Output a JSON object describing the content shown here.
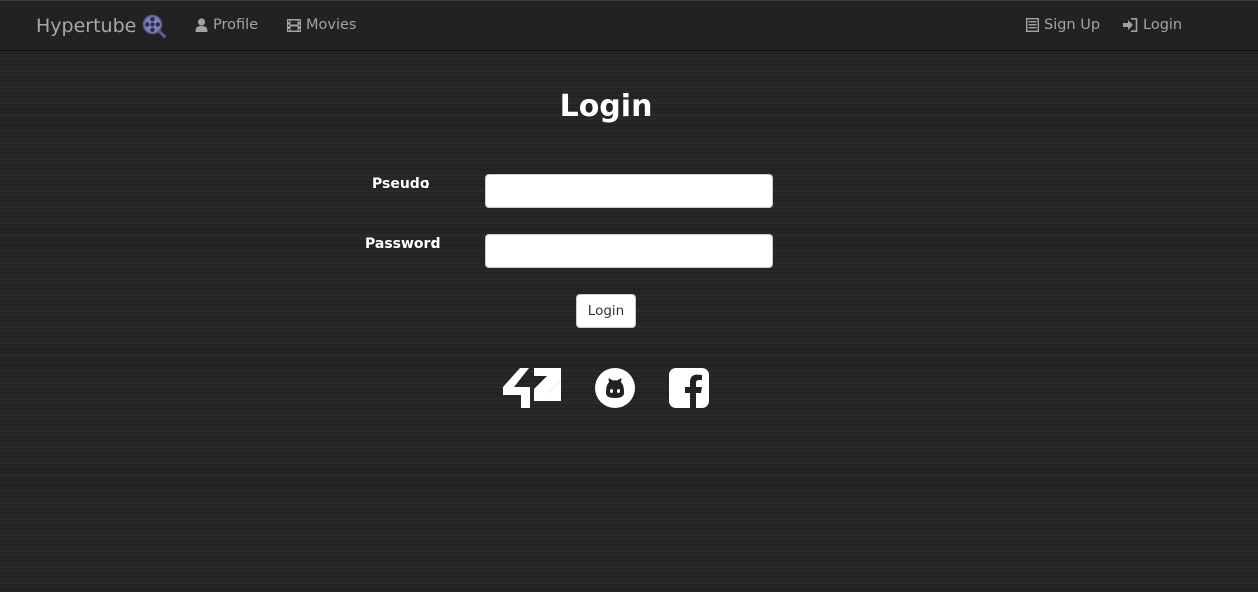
{
  "navbar": {
    "brand": "Hypertube",
    "brand_icon": "film-reel-search-icon",
    "links": [
      {
        "label": "Profile",
        "icon": "user-icon"
      },
      {
        "label": "Movies",
        "icon": "film-icon"
      }
    ],
    "right_links": [
      {
        "label": "Sign Up",
        "icon": "list-alt-icon"
      },
      {
        "label": "Login",
        "icon": "log-in-icon"
      }
    ]
  },
  "login": {
    "title": "Login",
    "pseudo_label": "Pseudo",
    "password_label": "Password",
    "colon": ":",
    "pseudo_value": "",
    "password_value": "",
    "submit_label": "Login"
  },
  "social": [
    {
      "name": "42",
      "icon": "42-logo-icon"
    },
    {
      "name": "GitHub",
      "icon": "github-icon"
    },
    {
      "name": "Facebook",
      "icon": "facebook-icon"
    }
  ],
  "colors": {
    "navbar_bg": "#222222",
    "page_bg": "#242424",
    "nav_text": "#a3a3a3",
    "brand_icon": "#6b6fa8",
    "text": "#ffffff"
  }
}
